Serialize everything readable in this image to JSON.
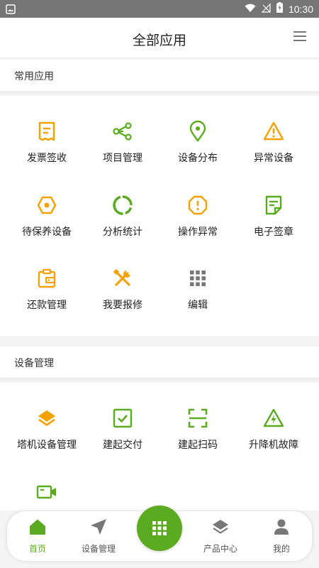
{
  "status_bar": {
    "time": "10:30"
  },
  "header": {
    "title": "全部应用"
  },
  "sections": [
    {
      "title": "常用应用",
      "items": [
        {
          "label": "发票签收",
          "icon": "receipt-icon",
          "color": "#f5a200"
        },
        {
          "label": "项目管理",
          "icon": "share-nodes-icon",
          "color": "#5aab1f"
        },
        {
          "label": "设备分布",
          "icon": "map-pin-icon",
          "color": "#5aab1f"
        },
        {
          "label": "异常设备",
          "icon": "warning-triangle-icon",
          "color": "#f5a200"
        },
        {
          "label": "待保养设备",
          "icon": "hexagon-nut-icon",
          "color": "#f5a200"
        },
        {
          "label": "分析统计",
          "icon": "ring-chart-icon",
          "color": "#5aab1f"
        },
        {
          "label": "操作异常",
          "icon": "alert-octagon-icon",
          "color": "#f5a200"
        },
        {
          "label": "电子签章",
          "icon": "document-seal-icon",
          "color": "#5aab1f"
        },
        {
          "label": "还款管理",
          "icon": "wallet-clipboard-icon",
          "color": "#f5a200"
        },
        {
          "label": "我要报修",
          "icon": "tools-icon",
          "color": "#f5a200"
        },
        {
          "label": "编辑",
          "icon": "grid-dots-icon",
          "color": "#777777"
        }
      ]
    },
    {
      "title": "设备管理",
      "items": [
        {
          "label": "塔机设备管理",
          "icon": "layers-icon",
          "color": "#f5a200"
        },
        {
          "label": "建起交付",
          "icon": "checkbox-icon",
          "color": "#5aab1f"
        },
        {
          "label": "建起扫码",
          "icon": "scan-icon",
          "color": "#5aab1f"
        },
        {
          "label": "升降机故障",
          "icon": "high-voltage-icon",
          "color": "#5aab1f"
        },
        {
          "label": "",
          "icon": "video-camera-icon",
          "color": "#5aab1f"
        }
      ]
    }
  ],
  "bottom_nav": {
    "items": [
      {
        "label": "首页",
        "icon": "home-icon",
        "active": true
      },
      {
        "label": "设备管理",
        "icon": "navigation-arrow-icon",
        "active": false
      },
      {
        "label": "产品中心",
        "icon": "layers-icon",
        "active": false
      },
      {
        "label": "我的",
        "icon": "person-icon",
        "active": false
      }
    ],
    "center_icon": "apps-grid-icon"
  },
  "colors": {
    "accent_green": "#5aab1f",
    "accent_orange": "#f5a200",
    "status_bar": "#757575"
  }
}
